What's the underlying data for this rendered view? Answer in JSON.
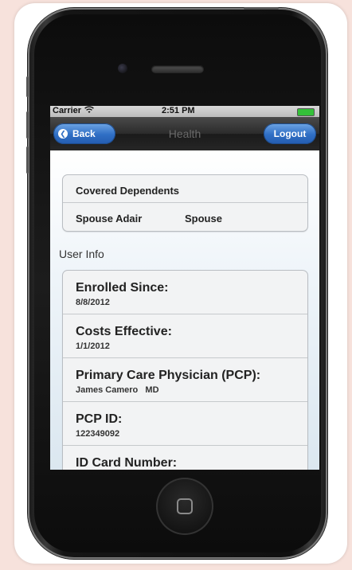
{
  "status_bar": {
    "carrier": "Carrier",
    "time": "2:51 PM"
  },
  "nav_bar": {
    "title": "Health",
    "back_label": "Back",
    "logout_label": "Logout"
  },
  "dependents": {
    "header": "Covered Dependents",
    "items": [
      {
        "name": "Spouse Adair",
        "relation": "Spouse"
      }
    ]
  },
  "user_info": {
    "section_label": "User Info",
    "items": [
      {
        "label": "Enrolled Since:",
        "value": "8/8/2012"
      },
      {
        "label": "Costs Effective:",
        "value": "1/1/2012"
      },
      {
        "label": "Primary Care Physician (PCP):",
        "value": "James Camero   MD"
      },
      {
        "label": "PCP ID:",
        "value": "122349092"
      },
      {
        "label": "ID Card Number:",
        "value": ""
      }
    ]
  },
  "colors": {
    "accent_blue": "#2f6ec4",
    "battery_green": "#34c039",
    "page_background": "#f7e2dc"
  }
}
